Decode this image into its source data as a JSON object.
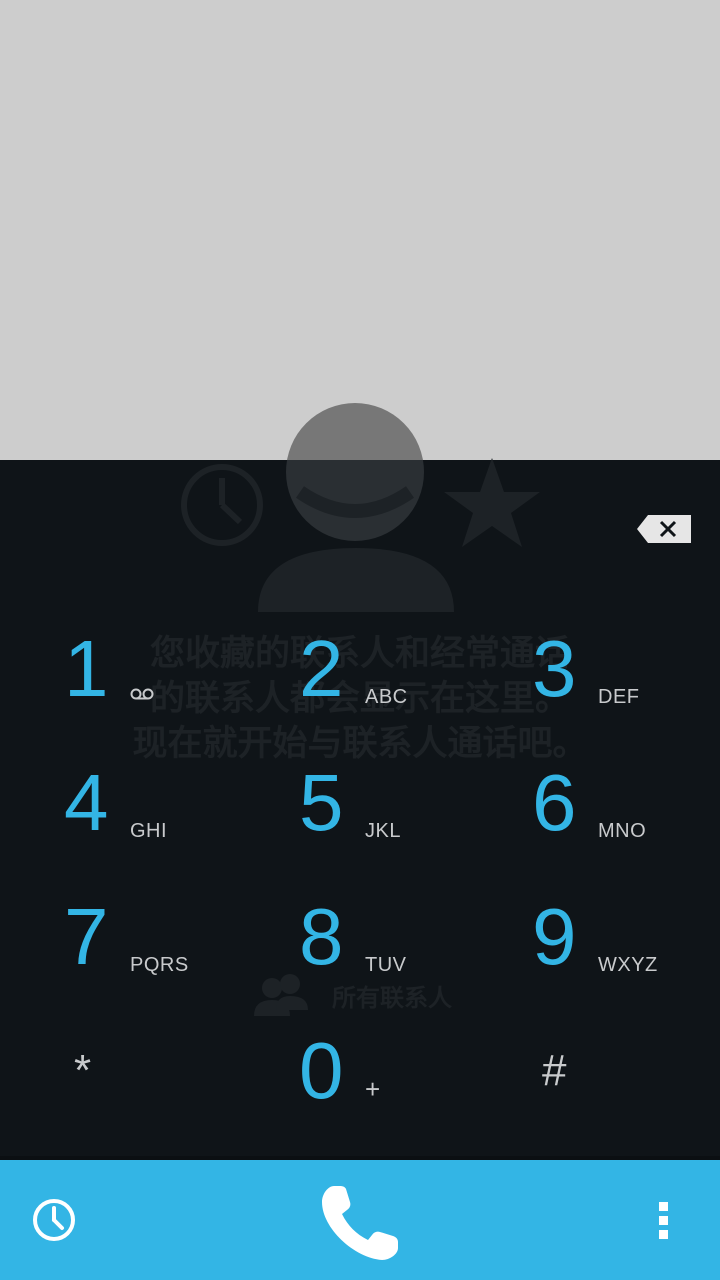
{
  "background": {
    "empty_message_line1": "您收藏的联系人和经常通话",
    "empty_message_line2": "的联系人都会显示在这里。",
    "empty_message_line3": "现在就开始与联系人通话吧。",
    "all_contacts_label": "所有联系人"
  },
  "keypad": {
    "keys": [
      {
        "digit": "1",
        "letters": ""
      },
      {
        "digit": "2",
        "letters": "ABC"
      },
      {
        "digit": "3",
        "letters": "DEF"
      },
      {
        "digit": "4",
        "letters": "GHI"
      },
      {
        "digit": "5",
        "letters": "JKL"
      },
      {
        "digit": "6",
        "letters": "MNO"
      },
      {
        "digit": "7",
        "letters": "PQRS"
      },
      {
        "digit": "8",
        "letters": "TUV"
      },
      {
        "digit": "9",
        "letters": "WXYZ"
      },
      {
        "symbol": "*"
      },
      {
        "digit": "0",
        "letters": "+"
      },
      {
        "symbol": "#"
      }
    ]
  },
  "icons": {
    "backspace": "backspace-icon",
    "voicemail": "voicemail-icon",
    "call_log": "clock-icon",
    "dial": "phone-icon",
    "overflow": "more-vert-icon"
  },
  "colors": {
    "accent": "#33b5e5",
    "panel": "#0f1418",
    "top_area": "#cdcdcd"
  }
}
